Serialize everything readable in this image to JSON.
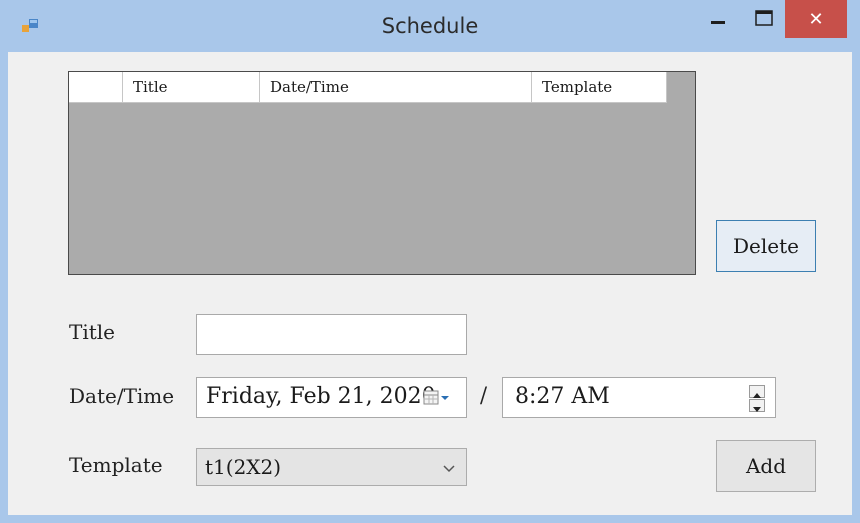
{
  "window": {
    "title": "Schedule",
    "close_glyph": "✕",
    "accent": "#a9c7ea",
    "close_color": "#c7504a"
  },
  "grid": {
    "columns": [
      "",
      "Title",
      "Date/Time",
      "Template"
    ],
    "rows": []
  },
  "buttons": {
    "delete_label": "Delete",
    "add_label": "Add"
  },
  "form": {
    "title_label": "Title",
    "title_value": "",
    "datetime_label": "Date/Time",
    "date_value": "Friday, Feb 21, 2020",
    "separator": "/",
    "time_value": "8:27 AM",
    "template_label": "Template",
    "template_value": "t1(2X2)"
  },
  "icons": {
    "app": "app-icon",
    "minimize": "minimize-icon",
    "maximize": "maximize-icon",
    "close": "close-icon",
    "calendar": "calendar-icon",
    "dropdown": "chevron-down-icon",
    "spin_up": "spin-up-icon",
    "spin_down": "spin-down-icon"
  }
}
